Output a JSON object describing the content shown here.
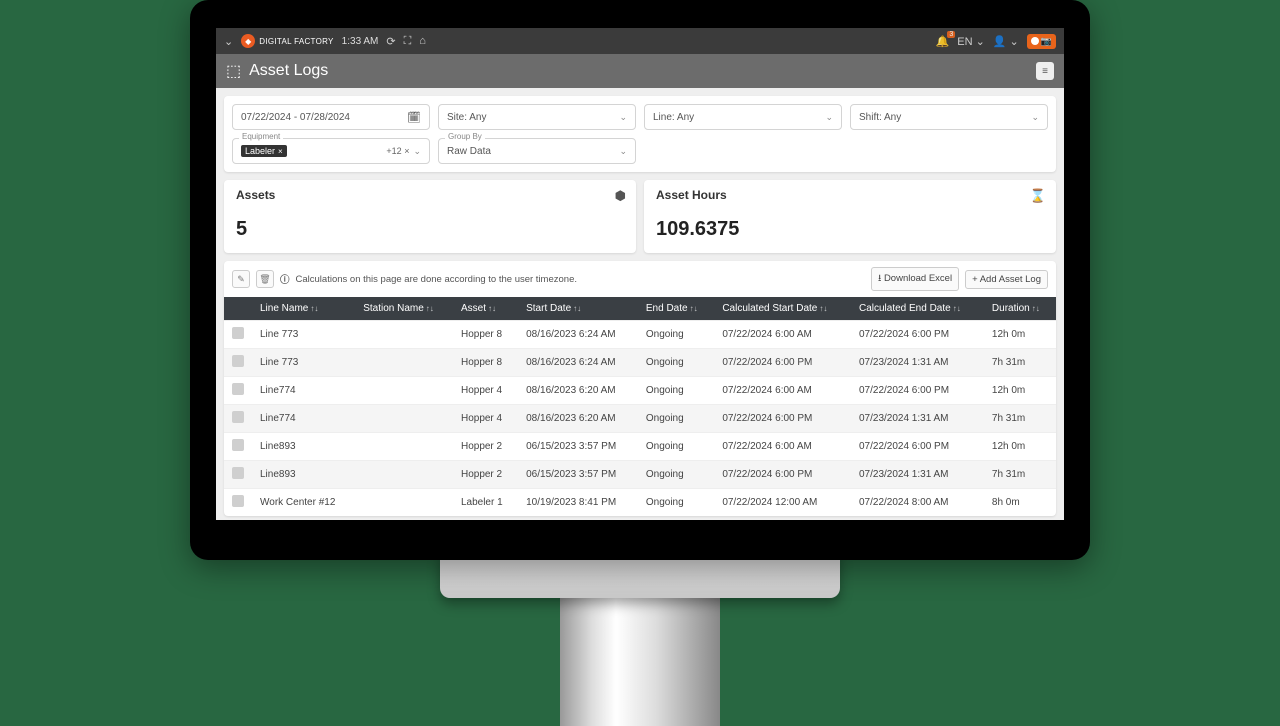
{
  "topbar": {
    "brand": "DIGITAL FACTORY",
    "time": "1:33 AM",
    "lang": "EN",
    "notif_count": "3"
  },
  "page": {
    "title": "Asset Logs"
  },
  "filters": {
    "date_range": "07/22/2024 - 07/28/2024",
    "site": "Site: Any",
    "line": "Line: Any",
    "shift": "Shift: Any",
    "equipment_label": "Equipment",
    "equipment_chip": "Labeler",
    "equipment_more": "+12 ×",
    "group_label": "Group By",
    "group_value": "Raw Data"
  },
  "stats": {
    "assets_label": "Assets",
    "assets_value": "5",
    "hours_label": "Asset Hours",
    "hours_value": "109.6375"
  },
  "toolbar": {
    "info": "Calculations on this page are done according to the user timezone.",
    "download": "Download Excel",
    "add": "+ Add Asset Log"
  },
  "table": {
    "cols": [
      "Line Name",
      "Station Name",
      "Asset",
      "Start Date",
      "End Date",
      "Calculated Start Date",
      "Calculated End Date",
      "Duration"
    ],
    "rows": [
      {
        "line": "Line 773",
        "station": "",
        "asset": "Hopper 8",
        "start": "08/16/2023 6:24 AM",
        "end": "Ongoing",
        "cstart": "07/22/2024 6:00 AM",
        "cend": "07/22/2024 6:00 PM",
        "dur": "12h 0m"
      },
      {
        "line": "Line 773",
        "station": "",
        "asset": "Hopper 8",
        "start": "08/16/2023 6:24 AM",
        "end": "Ongoing",
        "cstart": "07/22/2024 6:00 PM",
        "cend": "07/23/2024 1:31 AM",
        "dur": "7h 31m"
      },
      {
        "line": "Line774",
        "station": "",
        "asset": "Hopper 4",
        "start": "08/16/2023 6:20 AM",
        "end": "Ongoing",
        "cstart": "07/22/2024 6:00 AM",
        "cend": "07/22/2024 6:00 PM",
        "dur": "12h 0m"
      },
      {
        "line": "Line774",
        "station": "",
        "asset": "Hopper 4",
        "start": "08/16/2023 6:20 AM",
        "end": "Ongoing",
        "cstart": "07/22/2024 6:00 PM",
        "cend": "07/23/2024 1:31 AM",
        "dur": "7h 31m"
      },
      {
        "line": "Line893",
        "station": "",
        "asset": "Hopper 2",
        "start": "06/15/2023 3:57 PM",
        "end": "Ongoing",
        "cstart": "07/22/2024 6:00 AM",
        "cend": "07/22/2024 6:00 PM",
        "dur": "12h 0m"
      },
      {
        "line": "Line893",
        "station": "",
        "asset": "Hopper 2",
        "start": "06/15/2023 3:57 PM",
        "end": "Ongoing",
        "cstart": "07/22/2024 6:00 PM",
        "cend": "07/23/2024 1:31 AM",
        "dur": "7h 31m"
      },
      {
        "line": "Work Center #12",
        "station": "",
        "asset": "Labeler 1",
        "start": "10/19/2023 8:41 PM",
        "end": "Ongoing",
        "cstart": "07/22/2024 12:00 AM",
        "cend": "07/22/2024 8:00 AM",
        "dur": "8h 0m"
      }
    ]
  }
}
